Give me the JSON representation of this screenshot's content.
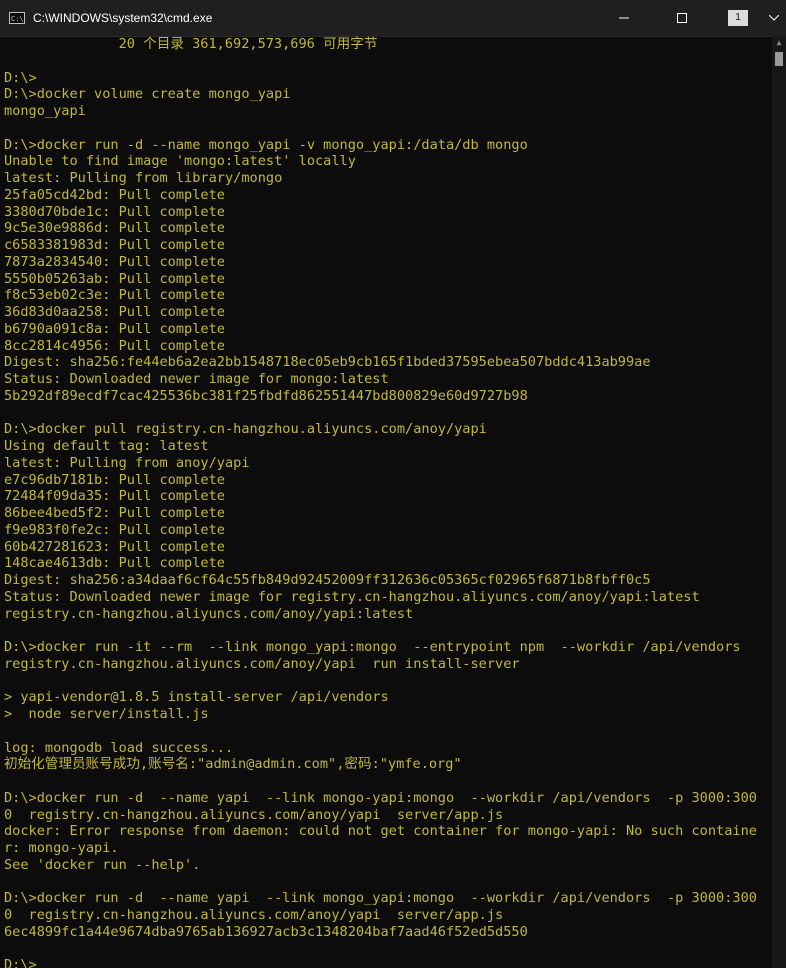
{
  "window": {
    "title": "C:\\WINDOWS\\system32\\cmd.exe",
    "app_icon": "cmd-icon",
    "tab_number": "1",
    "controls": {
      "minimize": "minimize-icon",
      "maximize": "maximize-icon",
      "more": "chevron-down-icon"
    },
    "text_color": "#c1b83c",
    "background": "#0c0c0c"
  },
  "console": {
    "lines": [
      "              20 个目录 361,692,573,696 可用字节",
      "",
      "D:\\>",
      "D:\\>docker volume create mongo_yapi",
      "mongo_yapi",
      "",
      "D:\\>docker run -d --name mongo_yapi -v mongo_yapi:/data/db mongo",
      "Unable to find image 'mongo:latest' locally",
      "latest: Pulling from library/mongo",
      "25fa05cd42bd: Pull complete",
      "3380d70bde1c: Pull complete",
      "9c5e30e9886d: Pull complete",
      "c6583381983d: Pull complete",
      "7873a2834540: Pull complete",
      "5550b05263ab: Pull complete",
      "f8c53eb02c3e: Pull complete",
      "36d83d0aa258: Pull complete",
      "b6790a091c8a: Pull complete",
      "8cc2814c4956: Pull complete",
      "Digest: sha256:fe44eb6a2ea2bb1548718ec05eb9cb165f1bded37595ebea507bddc413ab99ae",
      "Status: Downloaded newer image for mongo:latest",
      "5b292df89ecdf7cac425536bc381f25fbdfd862551447bd800829e60d9727b98",
      "",
      "D:\\>docker pull registry.cn-hangzhou.aliyuncs.com/anoy/yapi",
      "Using default tag: latest",
      "latest: Pulling from anoy/yapi",
      "e7c96db7181b: Pull complete",
      "72484f09da35: Pull complete",
      "86bee4bed5f2: Pull complete",
      "f9e983f0fe2c: Pull complete",
      "60b427281623: Pull complete",
      "148cae4613db: Pull complete",
      "Digest: sha256:a34daaf6cf64c55fb849d92452009ff312636c05365cf02965f6871b8fbff0c5",
      "Status: Downloaded newer image for registry.cn-hangzhou.aliyuncs.com/anoy/yapi:latest",
      "registry.cn-hangzhou.aliyuncs.com/anoy/yapi:latest",
      "",
      "D:\\>docker run -it --rm  --link mongo_yapi:mongo  --entrypoint npm  --workdir /api/vendors",
      "registry.cn-hangzhou.aliyuncs.com/anoy/yapi  run install-server",
      "",
      "> yapi-vendor@1.8.5 install-server /api/vendors",
      ">  node server/install.js",
      "",
      "log: mongodb load success...",
      "初始化管理员账号成功,账号名:\"admin@admin.com\",密码:\"ymfe.org\"",
      "",
      "D:\\>docker run -d  --name yapi  --link mongo-yapi:mongo  --workdir /api/vendors  -p 3000:300",
      "0  registry.cn-hangzhou.aliyuncs.com/anoy/yapi  server/app.js",
      "docker: Error response from daemon: could not get container for mongo-yapi: No such containe",
      "r: mongo-yapi.",
      "See 'docker run --help'.",
      "",
      "D:\\>docker run -d  --name yapi  --link mongo_yapi:mongo  --workdir /api/vendors  -p 3000:300",
      "0  registry.cn-hangzhou.aliyuncs.com/anoy/yapi  server/app.js",
      "6ec4899fc1a44e9674dba9765ab136927acb3c1348204baf7aad46f52ed5d550",
      ""
    ],
    "prompt": "D:\\>"
  }
}
